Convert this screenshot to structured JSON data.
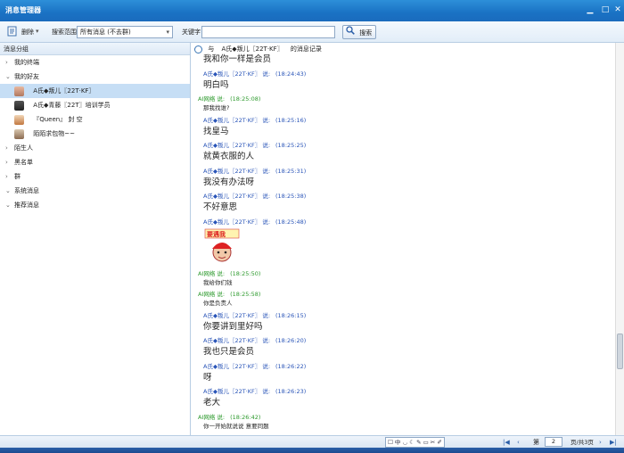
{
  "window": {
    "title": "消息管理器"
  },
  "toolbar": {
    "delete_label": "删除",
    "scope_label": "搜索范围",
    "scope_value": "所有消息 (不去群)",
    "keyword_label": "关键字",
    "keyword_value": "",
    "search_label": "搜索"
  },
  "sidebar": {
    "header": "消息分组",
    "groups": [
      {
        "label": "我的终端",
        "expanded": false
      },
      {
        "label": "我的好友",
        "expanded": true
      },
      {
        "label": "陌生人",
        "expanded": false
      },
      {
        "label": "黑名单",
        "expanded": false
      },
      {
        "label": "群",
        "expanded": false
      },
      {
        "label": "系统消息",
        "expanded": true
      },
      {
        "label": "推荐消息",
        "expanded": true
      }
    ],
    "friends": [
      {
        "name": "A氏◆叛儿〖22T·KF〗",
        "selected": true
      },
      {
        "name": "A氏◆青藤〖22T〗培训学员",
        "selected": false
      },
      {
        "name": "『Queen』 封 空",
        "selected": false
      },
      {
        "name": "陌陌求包物~~",
        "selected": false
      }
    ]
  },
  "chat": {
    "header_prefix": "与",
    "header_contact": "A氏◆叛儿〖22T·KF〗",
    "header_suffix": "的消息记录",
    "messages": [
      {
        "type": "body",
        "text": "我和你一样是会员",
        "big": true
      },
      {
        "type": "head",
        "sender": "A氏◆叛儿〖22T·KF〗 说:",
        "time": "(18:24:43)",
        "color": "blue"
      },
      {
        "type": "body",
        "text": "明白吗",
        "big": true
      },
      {
        "type": "head",
        "sender": "AI网络 说:",
        "time": "(18:25:08)",
        "color": "green"
      },
      {
        "type": "body",
        "text": "那我找谁?",
        "big": false
      },
      {
        "type": "head",
        "sender": "A氏◆叛儿〖22T·KF〗 说:",
        "time": "(18:25:16)",
        "color": "blue"
      },
      {
        "type": "body",
        "text": "找皇马",
        "big": true
      },
      {
        "type": "head",
        "sender": "A氏◆叛儿〖22T·KF〗 说:",
        "time": "(18:25:25)",
        "color": "blue"
      },
      {
        "type": "body",
        "text": "就黄衣服的人",
        "big": true
      },
      {
        "type": "head",
        "sender": "A氏◆叛儿〖22T·KF〗 说:",
        "time": "(18:25:31)",
        "color": "blue"
      },
      {
        "type": "body",
        "text": "我没有办法呀",
        "big": true
      },
      {
        "type": "head",
        "sender": "A氏◆叛儿〖22T·KF〗 说:",
        "time": "(18:25:38)",
        "color": "blue"
      },
      {
        "type": "body",
        "text": "不好意思",
        "big": true
      },
      {
        "type": "head",
        "sender": "A氏◆叛儿〖22T·KF〗 说:",
        "time": "(18:25:48)",
        "color": "blue"
      },
      {
        "type": "sticker",
        "text": "要遇我"
      },
      {
        "type": "head",
        "sender": "AI网络 说:",
        "time": "(18:25:50)",
        "color": "green"
      },
      {
        "type": "body",
        "text": "我给你们钱",
        "big": false
      },
      {
        "type": "head",
        "sender": "AI网络 说:",
        "time": "(18:25:58)",
        "color": "green"
      },
      {
        "type": "body",
        "text": "你是负责人",
        "big": false
      },
      {
        "type": "head",
        "sender": "A氏◆叛儿〖22T·KF〗 说:",
        "time": "(18:26:15)",
        "color": "blue"
      },
      {
        "type": "body",
        "text": "你要讲到里好吗",
        "big": true
      },
      {
        "type": "head",
        "sender": "A氏◆叛儿〖22T·KF〗 说:",
        "time": "(18:26:20)",
        "color": "blue"
      },
      {
        "type": "body",
        "text": "我也只是会员",
        "big": true
      },
      {
        "type": "head",
        "sender": "A氏◆叛儿〖22T·KF〗 说:",
        "time": "(18:26:22)",
        "color": "blue"
      },
      {
        "type": "body",
        "text": "呀",
        "big": true
      },
      {
        "type": "head",
        "sender": "A氏◆叛儿〖22T·KF〗 说:",
        "time": "(18:26:23)",
        "color": "blue"
      },
      {
        "type": "body",
        "text": "老大",
        "big": true
      },
      {
        "type": "head",
        "sender": "AI网络 说:",
        "time": "(18:26:42)",
        "color": "green"
      },
      {
        "type": "body",
        "text": "你一开始就说说 意要同题",
        "big": false
      }
    ]
  },
  "bottom": {
    "format_icons": "☐ 中 ◡ ☾ ✎ ▭ ✂ ✐",
    "page_prefix": "第",
    "page_value": "2",
    "page_suffix": "页/共3页",
    "first_icon": "first-page-icon",
    "prev_icon": "prev-page-icon",
    "next_icon": "next-page-icon",
    "last_icon": "last-page-icon"
  },
  "colors": {
    "title_bar": "#1a72c4",
    "sender_blue": "#2a55b8",
    "sender_green": "#2d9a2d",
    "selected_row": "#c6def5"
  }
}
